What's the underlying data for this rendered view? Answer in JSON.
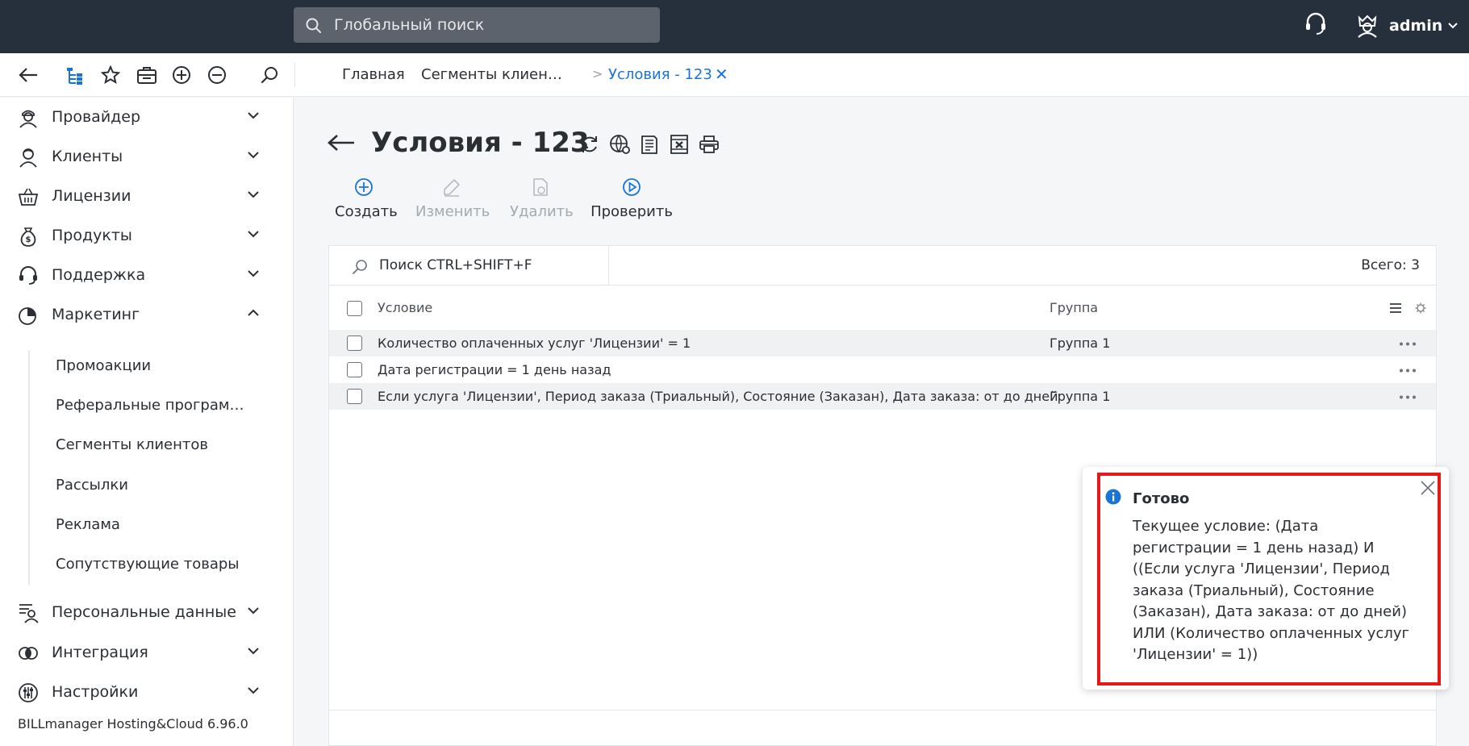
{
  "header": {
    "search_placeholder": "Глобальный поиск",
    "user_name": "admin"
  },
  "tabs": {
    "crumb_home": "Главная",
    "crumb_segments": "Сегменты клиен…",
    "crumb_separator": ">",
    "crumb_current": "Условия - 123",
    "close_glyph": "✕"
  },
  "sidebar": {
    "items": [
      {
        "label": "Провайдер",
        "icon": "provider-icon",
        "expanded": false
      },
      {
        "label": "Клиенты",
        "icon": "clients-icon",
        "expanded": false
      },
      {
        "label": "Лицензии",
        "icon": "basket-icon",
        "expanded": false
      },
      {
        "label": "Продукты",
        "icon": "money-bag-icon",
        "expanded": false
      },
      {
        "label": "Поддержка",
        "icon": "headset-icon",
        "expanded": false
      },
      {
        "label": "Маркетинг",
        "icon": "pie-chart-icon",
        "expanded": true
      },
      {
        "label": "Персональные данные",
        "icon": "personal-data-icon",
        "expanded": false
      },
      {
        "label": "Интеграция",
        "icon": "integration-icon",
        "expanded": false
      },
      {
        "label": "Настройки",
        "icon": "settings-sliders-icon",
        "expanded": false
      }
    ],
    "sub_items": [
      "Промоакции",
      "Реферальные програм…",
      "Сегменты клиентов",
      "Рассылки",
      "Реклама",
      "Сопутствующие товары"
    ],
    "version": "BILLmanager Hosting&Cloud 6.96.0"
  },
  "page": {
    "title": "Условия - 123"
  },
  "toolbar": {
    "create": "Создать",
    "edit": "Изменить",
    "delete": "Удалить",
    "check": "Проверить"
  },
  "list": {
    "search_placeholder": "Поиск CTRL+SHIFT+F",
    "total": "Всего: 3",
    "col_condition": "Условие",
    "col_group": "Группа",
    "rows": [
      {
        "condition": "Количество оплаченных услуг 'Лицензии' = 1",
        "group": "Группа 1"
      },
      {
        "condition": "Дата регистрации = 1 день назад",
        "group": ""
      },
      {
        "condition": "Если услуга 'Лицензии', Период заказа (Триальный), Состояние (Заказан), Дата заказа: от до дней",
        "group": "Группа 1"
      }
    ]
  },
  "notification": {
    "title": "Готово",
    "body": "Текущее условие: (Дата регистрации = 1 день назад) И ((Если услуга 'Лицензии', Период заказа (Триальный), Состояние (Заказан), Дата заказа: от до дней) ИЛИ (Количество оплаченных услуг 'Лицензии' = 1))"
  },
  "colors": {
    "topbar": "#262f3c",
    "accent": "#1a74d8",
    "highlight_frame": "#e61919"
  }
}
